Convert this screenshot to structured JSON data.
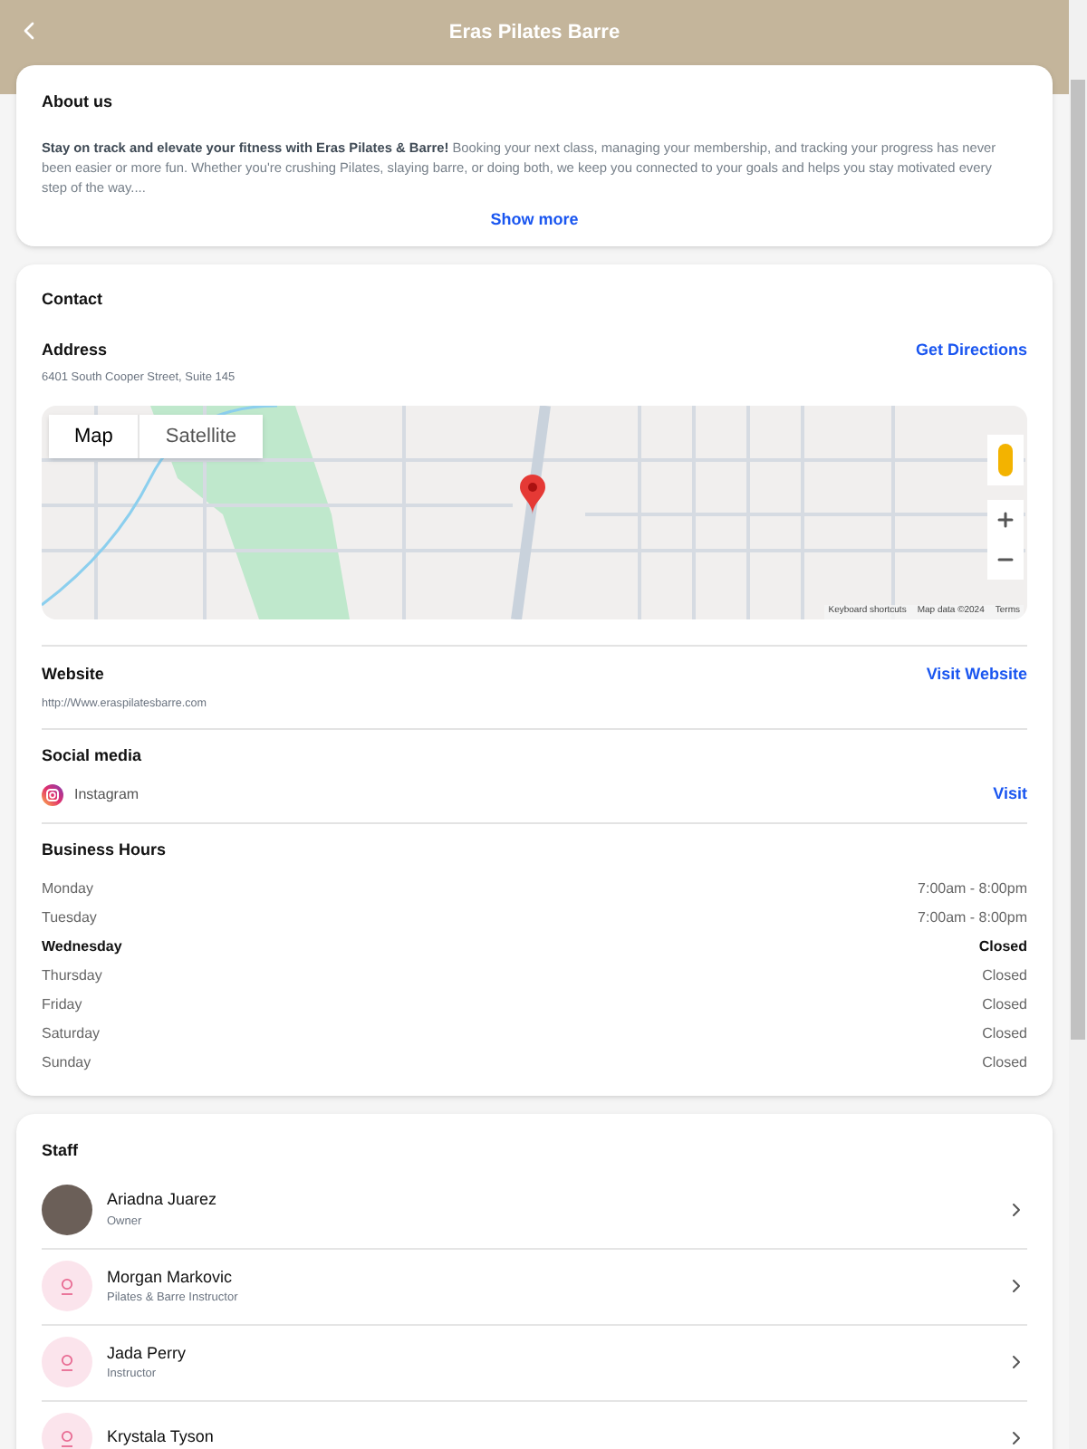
{
  "header": {
    "title": "Eras Pilates Barre"
  },
  "about": {
    "title": "About us",
    "text": "**Stay on track and elevate your fitness with Eras Pilates & Barre!** Booking your next class, managing your membership, and tracking your progress has never been easier or more fun. Whether you're crushing Pilates, slaying barre, or doing both, we keep you connected to your goals and helps you stay motivated every step of the way....",
    "link": "Show more"
  },
  "contact": {
    "title": "Contact",
    "address": {
      "label": "Address",
      "value": "6401 South Cooper Street, Suite 145",
      "link": "Get Directions"
    },
    "map": {
      "tabs": [
        {
          "label": "Map",
          "selected": true
        },
        {
          "label": "Satellite",
          "selected": false
        }
      ],
      "footer": [
        "Keyboard shortcuts",
        "Map data ©2024",
        "Terms"
      ]
    },
    "website": {
      "label": "Website",
      "value": "http://Www.eraspilatesbarre.com",
      "link": "Visit Website"
    },
    "social": {
      "label": "Social media",
      "name": "Instagram",
      "link": "Visit"
    },
    "hours": {
      "label": "Business Hours",
      "days": [
        {
          "day": "Monday",
          "time": "7:00am - 8:00pm",
          "today": false
        },
        {
          "day": "Tuesday",
          "time": "7:00am - 8:00pm",
          "today": false
        },
        {
          "day": "Wednesday",
          "time": "Closed",
          "today": true
        },
        {
          "day": "Thursday",
          "time": "Closed",
          "today": false
        },
        {
          "day": "Friday",
          "time": "Closed",
          "today": false
        },
        {
          "day": "Saturday",
          "time": "Closed",
          "today": false
        },
        {
          "day": "Sunday",
          "time": "Closed",
          "today": false
        }
      ]
    }
  },
  "staff": {
    "title": "Staff",
    "members": [
      {
        "name": "Ariadna Juarez",
        "role": "Owner",
        "kind": "photo"
      },
      {
        "name": "Morgan Markovic",
        "role": "Pilates & Barre Instructor",
        "kind": "placeholder"
      },
      {
        "name": "Jada Perry",
        "role": "Instructor",
        "kind": "placeholder"
      },
      {
        "name": "Krystala Tyson",
        "kind": "placeholder"
      }
    ]
  }
}
